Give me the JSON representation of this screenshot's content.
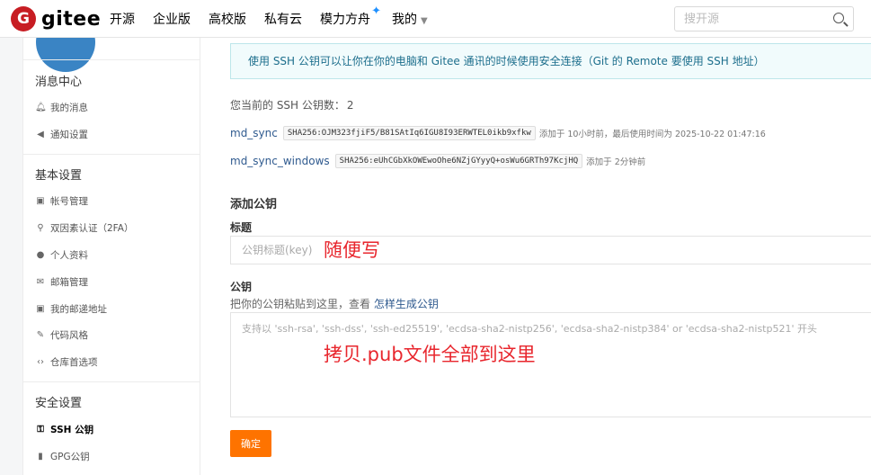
{
  "topbar": {
    "logo_text": "gitee",
    "nav": [
      {
        "label": "开源"
      },
      {
        "label": "企业版"
      },
      {
        "label": "高校版"
      },
      {
        "label": "私有云"
      },
      {
        "label": "模力方舟"
      },
      {
        "label": "我的"
      }
    ],
    "search_placeholder": "搜开源"
  },
  "sidebar": {
    "sections": [
      {
        "title": "消息中心",
        "items": [
          {
            "label": "我的消息",
            "icon": "bell-icon"
          },
          {
            "label": "通知设置",
            "icon": "speaker-icon"
          }
        ]
      },
      {
        "title": "基本设置",
        "items": [
          {
            "label": "帐号管理",
            "icon": "id-card-icon"
          },
          {
            "label": "双因素认证（2FA）",
            "icon": "user-shield-icon"
          },
          {
            "label": "个人资料",
            "icon": "user-icon"
          },
          {
            "label": "邮箱管理",
            "icon": "envelope-icon"
          },
          {
            "label": "我的邮递地址",
            "icon": "address-card-icon"
          },
          {
            "label": "代码风格",
            "icon": "brush-icon"
          },
          {
            "label": "仓库首选项",
            "icon": "code-icon"
          }
        ]
      },
      {
        "title": "安全设置",
        "items": [
          {
            "label": "SSH 公钥",
            "icon": "key-icon",
            "active": true
          },
          {
            "label": "GPG公钥",
            "icon": "lock-icon"
          }
        ]
      }
    ]
  },
  "main": {
    "notice": "使用 SSH 公钥可以让你在你的电脑和 Gitee 通讯的时候使用安全连接（Git 的 Remote 要使用 SSH 地址）",
    "count_label": "您当前的 SSH 公钥数：",
    "count_value": "2",
    "keys": [
      {
        "name": "md_sync",
        "hash": "SHA256:OJM323fjiF5/B81SAtIq6IGU8I93ERWTEL0ikb9xfkw",
        "meta": "添加于 10小时前，最后使用时间为 2025-10-22 01:47:16"
      },
      {
        "name": "md_sync_windows",
        "hash": "SHA256:eUhCGbXkOWEwoOhe6NZjGYyyQ+osWu6GRTh97KcjHQ",
        "meta": "添加于 2分钟前"
      }
    ],
    "add_heading": "添加公钥",
    "title_label": "标题",
    "title_placeholder": "公钥标题(key)",
    "key_label": "公钥",
    "key_hint": "把你的公钥粘贴到这里，查看",
    "key_hint_link": "怎样生成公钥",
    "key_placeholder": "支持以 'ssh-rsa', 'ssh-dss', 'ssh-ed25519', 'ecdsa-sha2-nistp256', 'ecdsa-sha2-nistp384' or 'ecdsa-sha2-nistp521' 开头",
    "submit_label": "确定"
  },
  "annotations": {
    "title_note": "随便写",
    "key_note": "拷贝.pub文件全部到这里"
  },
  "colors": {
    "brand": "#c71d23",
    "submit": "#fe7300",
    "annotation": "#e8262d",
    "link": "#2f5a8f"
  }
}
